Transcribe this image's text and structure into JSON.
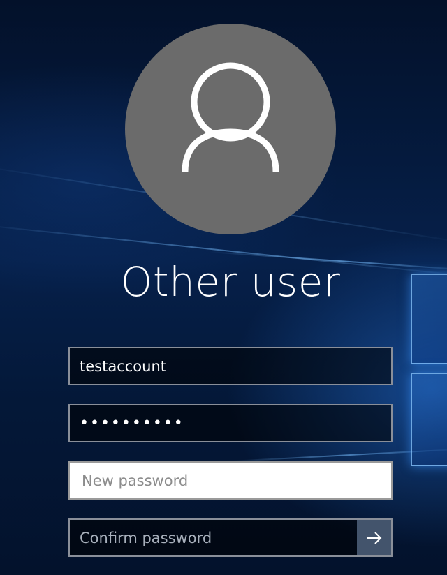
{
  "user": {
    "name": "Other user"
  },
  "fields": {
    "username": {
      "value": "testaccount"
    },
    "password": {
      "value": "••••••••••"
    },
    "new_password": {
      "placeholder": "New password"
    },
    "confirm_password": {
      "placeholder": "Confirm password"
    }
  },
  "icons": {
    "avatar": "user-silhouette-icon",
    "submit": "arrow-right-icon"
  },
  "colors": {
    "avatar_bg": "#6b6b6b",
    "field_border": "#8a8f99",
    "submit_bg": "#43546c",
    "wallpaper_accent": "#2a7ee0"
  }
}
